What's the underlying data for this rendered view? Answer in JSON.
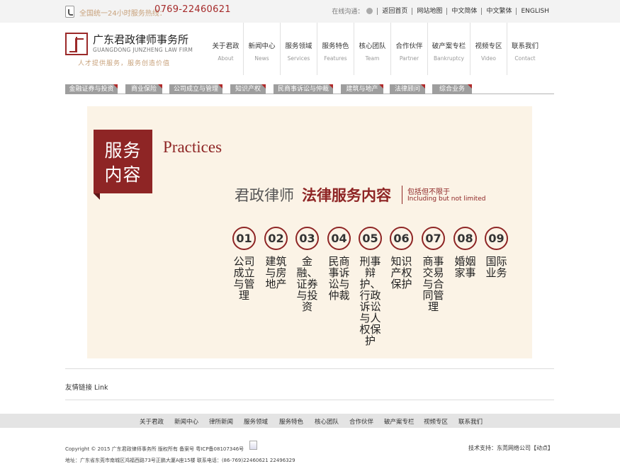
{
  "topbar": {
    "hotline_label": "全国统一24小时服务热线：",
    "hotline_number": "0769-22460621",
    "online_label": "在线沟通：",
    "links": [
      "返回首页",
      "网站地图",
      "中文简体",
      "中文繁体",
      "ENGLISH"
    ]
  },
  "header": {
    "logo_cn": "广东君政律师事务所",
    "logo_en": "GUANGDONG JUNZHENG LAW FIRM",
    "slogan": "人才提供服务，服务创造价值"
  },
  "nav": [
    {
      "cn": "关于君政",
      "en": "About"
    },
    {
      "cn": "新闻中心",
      "en": "News"
    },
    {
      "cn": "服务领域",
      "en": "Services"
    },
    {
      "cn": "服务特色",
      "en": "Features"
    },
    {
      "cn": "核心团队",
      "en": "Team"
    },
    {
      "cn": "合作伙伴",
      "en": "Partner"
    },
    {
      "cn": "破产案专栏",
      "en": "Bankruptcy"
    },
    {
      "cn": "视频专区",
      "en": "Video"
    },
    {
      "cn": "联系我们",
      "en": "Contact"
    }
  ],
  "categories": [
    "金融证券与投资",
    "商业保险",
    "公司成立与管理",
    "知识产权",
    "民商事诉讼与仲裁",
    "建筑与地产",
    "法律顾问",
    "综合业务"
  ],
  "panel": {
    "banner_line1": "服务",
    "banner_line2": "内容",
    "practices": "Practices",
    "heading_a": "君政律师",
    "heading_b": "法律服务内容",
    "sub_cn": "包括但不限于",
    "sub_en": "Including but not limited",
    "services": [
      {
        "num": "01",
        "text": "公司成立与管理"
      },
      {
        "num": "02",
        "text": "建筑与房地产"
      },
      {
        "num": "03",
        "text": "金融、证券与投资"
      },
      {
        "num": "04",
        "text": "民商事诉讼与仲裁"
      },
      {
        "num": "05",
        "text": "刑事辩护、行政诉讼与人权保护"
      },
      {
        "num": "06",
        "text": "知识产权保护"
      },
      {
        "num": "07",
        "text": "商事交易与合同管理"
      },
      {
        "num": "08",
        "text": "婚姻家事"
      },
      {
        "num": "09",
        "text": "国际业务"
      }
    ]
  },
  "footer": {
    "links_label": "友情链接 Link",
    "nav": [
      "关于君政",
      "新闻中心",
      "律所新闻",
      "服务领域",
      "服务特色",
      "核心团队",
      "合作伙伴",
      "破产案专栏",
      "视频专区",
      "联系我们"
    ],
    "copyright": "Copyright © 2015 广东君政律师事务所 版权所有 备案号 粤ICP备08107346号",
    "tech": "技术支持：东莞网络公司【动点】",
    "address": "地址：广东省东莞市南城区鸿福西路73号正鹏大厦A座15楼 联系电话：(86-769)22460621  22496329"
  },
  "colors": {
    "brand": "#8e2525",
    "accent": "#c8a27c",
    "panel_bg": "#fbf3e6"
  }
}
